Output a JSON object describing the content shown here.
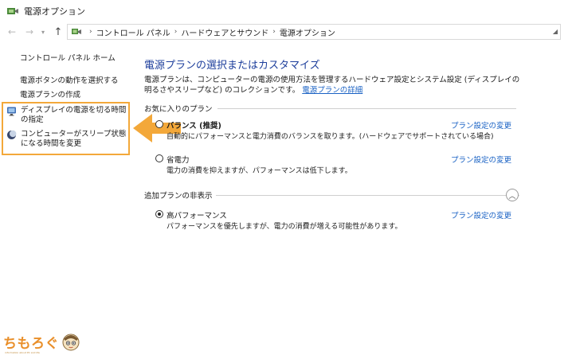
{
  "window": {
    "title": "電源オプション"
  },
  "nav": {
    "breadcrumb": [
      "コントロール パネル",
      "ハードウェアとサウンド",
      "電源オプション"
    ],
    "address_end": "◢"
  },
  "sidebar": {
    "home": "コントロール パネル ホーム",
    "power_button": "電源ボタンの動作を選択する",
    "create_plan": "電源プランの作成",
    "display_off": "ディスプレイの電源を切る時間の指定",
    "sleep": "コンピューターがスリープ状態になる時間を変更"
  },
  "main": {
    "title": "電源プランの選択またはカスタマイズ",
    "description": "電源プランは、コンピューターの電源の使用方法を管理するハードウェア設定とシステム設定 (ディスプレイの明るさやスリープなど) のコレクションです。",
    "description_link": "電源プランの詳細",
    "favorites_label": "お気に入りのプラン",
    "extra_label": "追加プランの非表示",
    "change_link": "プラン設定の変更",
    "plans": [
      {
        "name": "バランス (推奨)",
        "desc": "自動的にパフォーマンスと電力消費のバランスを取ります。(ハードウェアでサポートされている場合)",
        "checked": false
      },
      {
        "name": "省電力",
        "desc": "電力の消費を抑えますが、パフォーマンスは低下します。",
        "checked": false
      },
      {
        "name": "高パフォーマンス",
        "desc": "パフォーマンスを優先しますが、電力の消費が増える可能性があります。",
        "checked": true
      }
    ]
  },
  "branding": {
    "logo_text": "ちもろぐ",
    "logo_sub": "information about PC and life"
  },
  "colors": {
    "accent_orange": "#f3a83a",
    "link_blue": "#1a62c4",
    "title_blue": "#1e3f9c"
  }
}
